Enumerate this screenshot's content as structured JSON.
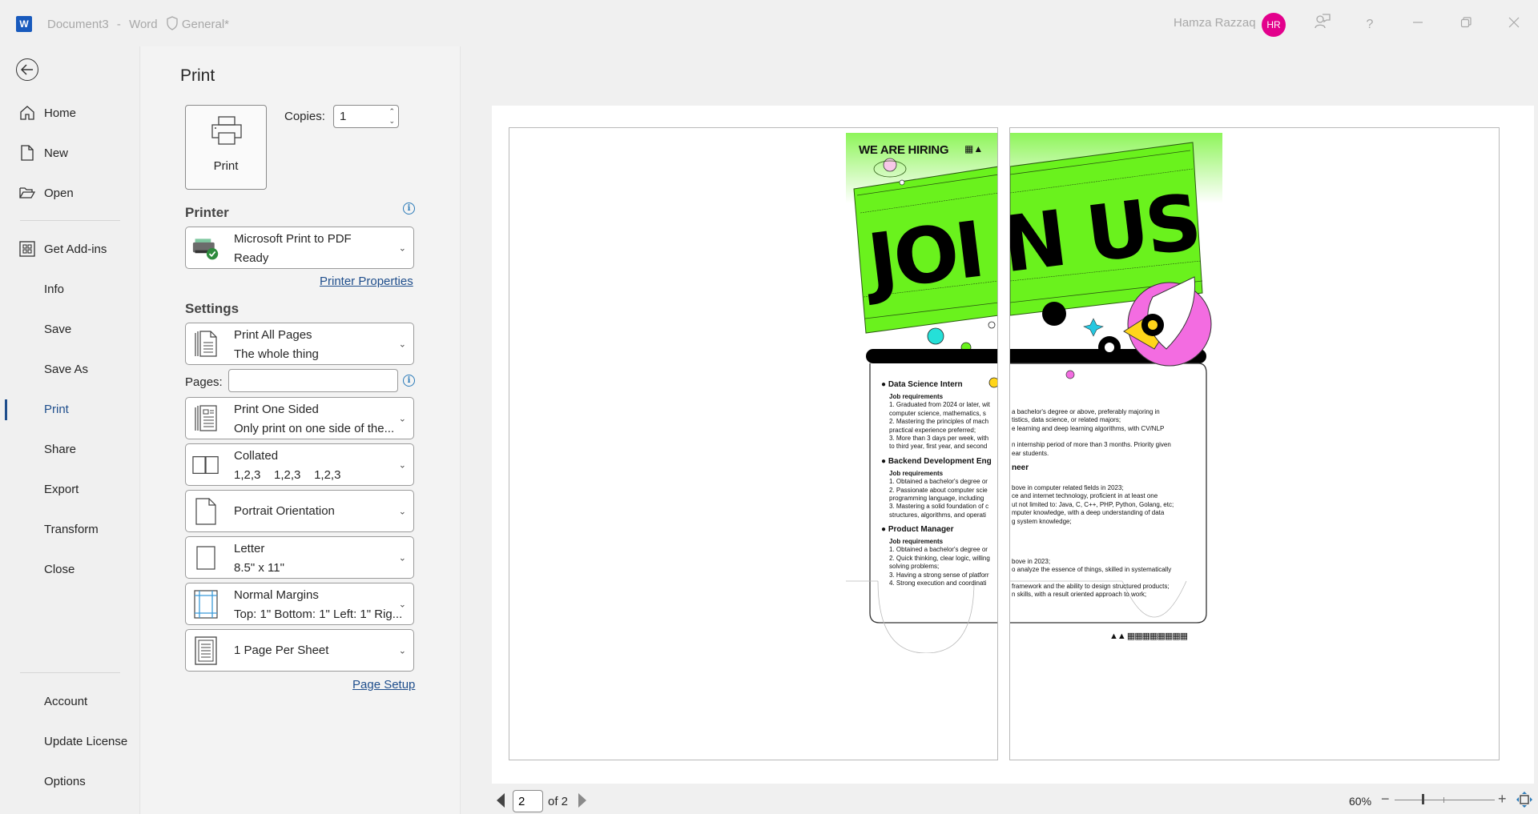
{
  "titlebar": {
    "app_icon": "word-icon",
    "document": "Document3",
    "separator": "-",
    "app_name": "Word",
    "sensitivity_label": "General*",
    "user_name": "Hamza Razzaq",
    "user_initials": "HR",
    "avatar_color": "#e3008c",
    "buttons": [
      "feedback-icon",
      "help-icon",
      "minimize-icon",
      "restore-icon",
      "close-icon"
    ]
  },
  "sidebar": {
    "back_icon": "back-arrow-icon",
    "items": [
      {
        "label": "Home",
        "icon": "home-icon"
      },
      {
        "label": "New",
        "icon": "new-document-icon"
      },
      {
        "label": "Open",
        "icon": "folder-open-icon"
      },
      {
        "label": "Get Add-ins",
        "icon": "add-ins-grid-icon"
      },
      {
        "label": "Info"
      },
      {
        "label": "Save"
      },
      {
        "label": "Save As"
      },
      {
        "label": "Print",
        "active": true
      },
      {
        "label": "Share"
      },
      {
        "label": "Export"
      },
      {
        "label": "Transform"
      },
      {
        "label": "Close"
      }
    ],
    "bottom_items": [
      {
        "label": "Account"
      },
      {
        "label": "Update License"
      },
      {
        "label": "Options"
      }
    ]
  },
  "print_panel": {
    "title": "Print",
    "print_button_label": "Print",
    "copies_label": "Copies:",
    "copies_value": "1",
    "printer_section": "Printer",
    "printer": {
      "name": "Microsoft Print to PDF",
      "status": "Ready"
    },
    "printer_properties_link": "Printer Properties",
    "settings_section": "Settings",
    "pages_label": "Pages:",
    "pages_value": "",
    "settings": [
      {
        "line1": "Print All Pages",
        "line2": "The whole thing",
        "icon": "pages-stack-icon"
      },
      {
        "line1": "Print One Sided",
        "line2": "Only print on one side of the...",
        "icon": "one-sided-icon"
      },
      {
        "line1": "Collated",
        "line2": "1,2,3    1,2,3    1,2,3",
        "icon": "collated-icon"
      },
      {
        "line1": "Portrait Orientation",
        "line2": "",
        "icon": "portrait-icon"
      },
      {
        "line1": "Letter",
        "line2": "8.5\" x 11\"",
        "icon": "paper-size-icon"
      },
      {
        "line1": "Normal Margins",
        "line2": "Top: 1\" Bottom: 1\" Left: 1\" Rig...",
        "icon": "margins-icon"
      },
      {
        "line1": "1 Page Per Sheet",
        "line2": "",
        "icon": "page-per-sheet-icon"
      }
    ],
    "page_setup_link": "Page Setup"
  },
  "preview": {
    "poster": {
      "header": "WE ARE HIRING",
      "headline_left": "JOI",
      "headline_right": "N US",
      "brand_green": "#6af21d",
      "jobs": [
        {
          "title": "Data Science Intern",
          "requirements_label": "Job requirements",
          "lines_left": [
            "1. Graduated from 2024 or later, wit",
            "computer science, mathematics, s",
            "2. Mastering the principles of mach",
            "practical experience preferred;",
            "3. More than 3 days per week, with",
            "to third year, first year, and second"
          ],
          "lines_right": [
            "a bachelor's degree or above, preferably majoring in",
            "tistics, data science, or related majors;",
            "e learning and deep learning algorithms, with CV/NLP",
            "",
            "n internship period of more than 3 months. Priority given",
            "ear students."
          ]
        },
        {
          "title": "Backend Development Eng",
          "title_right": "neer",
          "requirements_label": "Job requirements",
          "lines_left": [
            "1. Obtained a bachelor's degree or",
            "2. Passionate about computer scie",
            "programming language, including",
            "3. Mastering a solid foundation of c",
            "structures, algorithms, and operati"
          ],
          "lines_right": [
            "bove in computer related fields in 2023;",
            "ce and internet technology, proficient in at least one",
            "ut not limited to: Java, C, C++, PHP, Python, Golang, etc;",
            "mputer knowledge, with a deep understanding of data",
            "g system knowledge;"
          ]
        },
        {
          "title": "Product Manager",
          "requirements_label": "Job requirements",
          "lines_left": [
            "1. Obtained a bachelor's degree or",
            "2. Quick thinking, clear logic, willing",
            "solving problems;",
            "3. Having a strong sense of platforr",
            "4. Strong execution and coordinati"
          ],
          "lines_right": [
            "bove in 2023;",
            "o analyze the essence of things, skilled in systematically",
            "",
            "framework and the ability to design structured products;",
            "n skills, with a result oriented approach to work;"
          ]
        }
      ]
    }
  },
  "footer": {
    "current_page": "2",
    "of_label": "of 2",
    "zoom_level": "60%",
    "zoom_fraction": 0.27
  }
}
